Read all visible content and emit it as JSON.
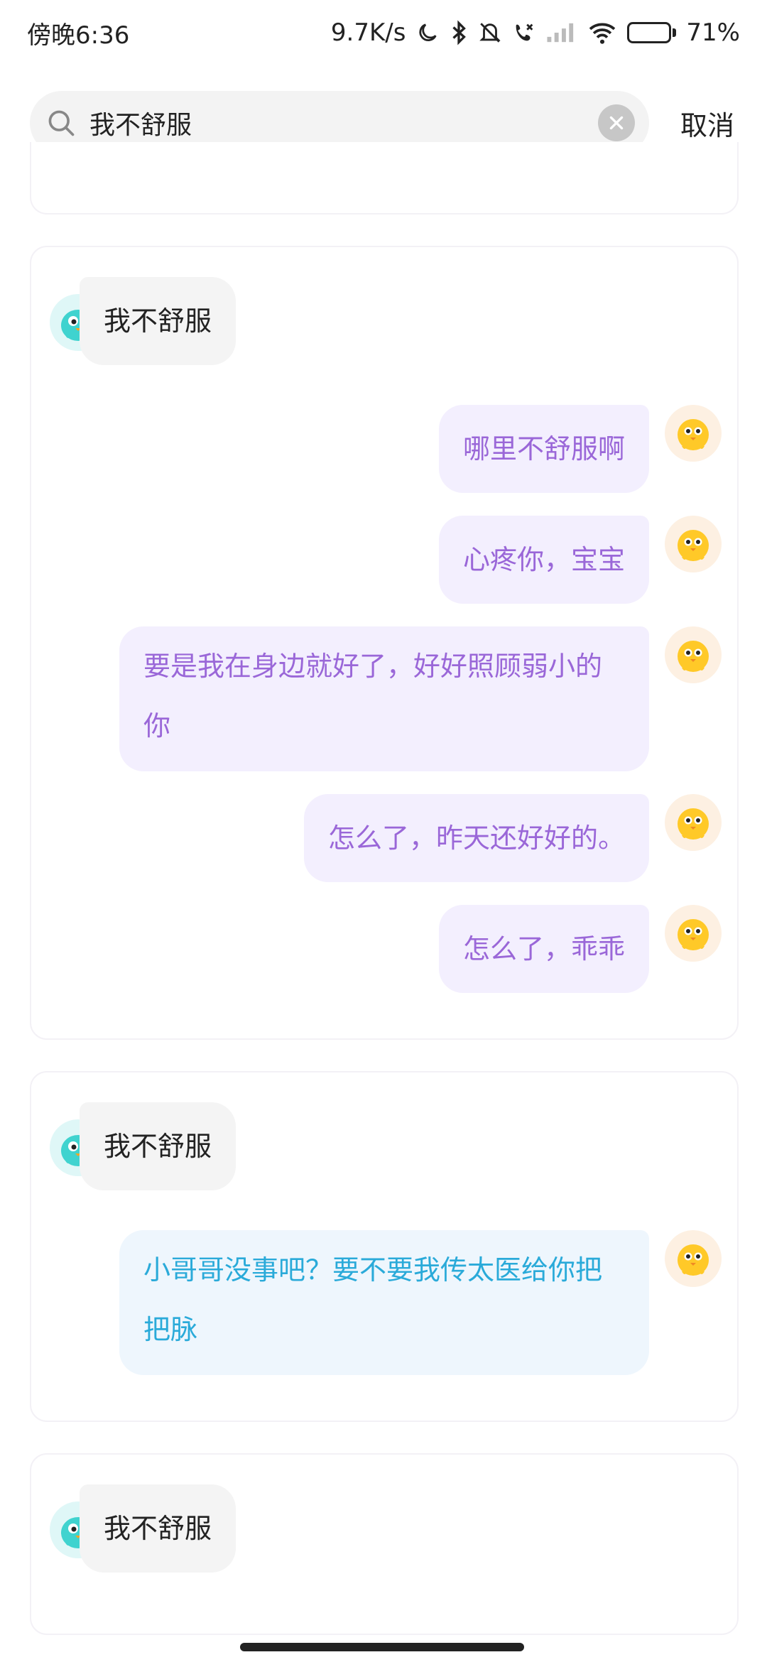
{
  "status_bar": {
    "time": "傍晚6:36",
    "network_speed": "9.7K/s",
    "battery_percent": "71%",
    "battery_level": 0.71,
    "icons": [
      "moon-icon",
      "bluetooth-icon",
      "mute-icon",
      "missed-call-icon",
      "signal-icon",
      "wifi-icon",
      "battery-icon"
    ]
  },
  "search": {
    "query": "我不舒服",
    "cancel_label": "取消"
  },
  "results": [
    {
      "user_message": "我不舒服",
      "replies": [
        "哪里不舒服啊",
        "心疼你，宝宝",
        "要是我在身边就好了，好好照顾弱小的你",
        "怎么了，昨天还好好的。",
        "怎么了，乖乖"
      ],
      "reply_color": "#9a67d8"
    },
    {
      "user_message": "我不舒服",
      "replies": [
        "小哥哥没事吧？要不要我传太医给你把把脉"
      ],
      "reply_color": "#2aaad9"
    },
    {
      "user_message": "我不舒服",
      "replies": []
    }
  ]
}
